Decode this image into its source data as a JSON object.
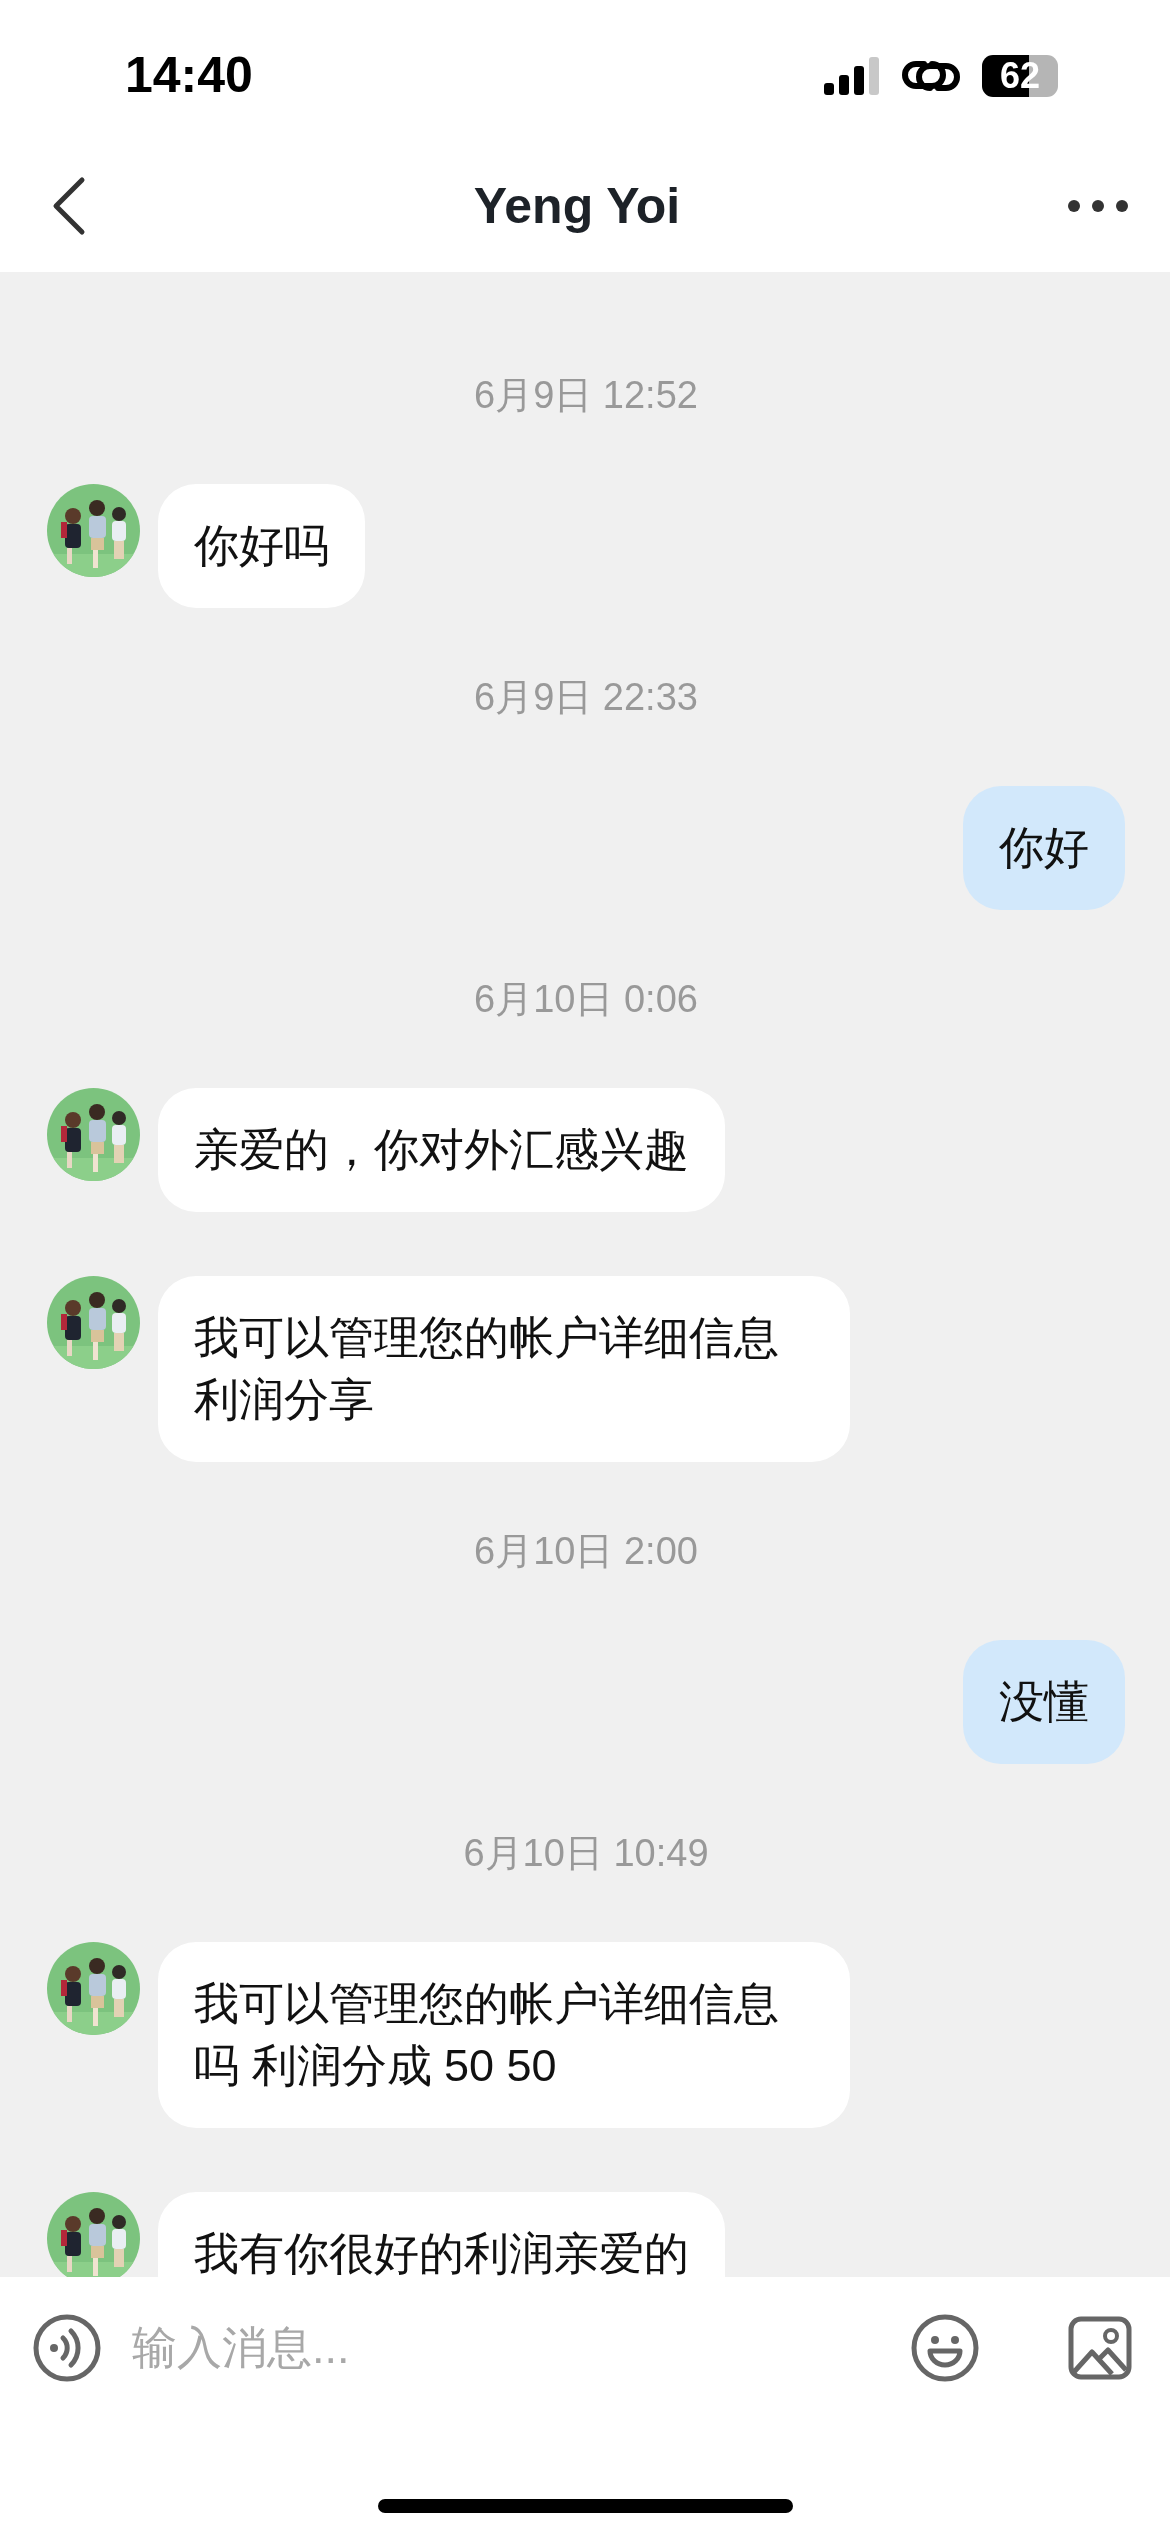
{
  "status_bar": {
    "time": "14:40",
    "battery": "62"
  },
  "header": {
    "title": "Yeng Yoi"
  },
  "messages": [
    {
      "kind": "timestamp",
      "text": "6月9日 12:52"
    },
    {
      "kind": "incoming",
      "text": "你好吗"
    },
    {
      "kind": "timestamp",
      "text": "6月9日 22:33"
    },
    {
      "kind": "outgoing",
      "text": "你好"
    },
    {
      "kind": "timestamp",
      "text": "6月10日 0:06"
    },
    {
      "kind": "incoming",
      "text": "亲爱的，你对外汇感兴趣"
    },
    {
      "kind": "incoming",
      "text": "我可以管理您的帐户详细信息利润分享"
    },
    {
      "kind": "timestamp",
      "text": "6月10日 2:00"
    },
    {
      "kind": "outgoing",
      "text": "没懂"
    },
    {
      "kind": "timestamp",
      "text": "6月10日 10:49"
    },
    {
      "kind": "incoming",
      "text": "我可以管理您的帐户详细信息吗 利润分成 50 50"
    },
    {
      "kind": "incoming",
      "text": "我有你很好的利润亲爱的"
    }
  ],
  "composer": {
    "placeholder": "输入消息..."
  }
}
